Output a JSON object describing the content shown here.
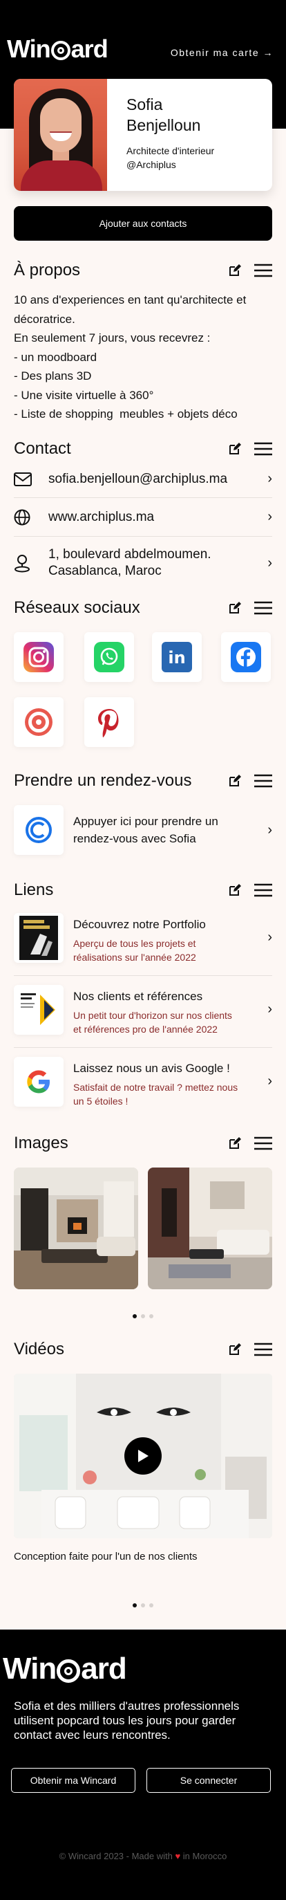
{
  "header": {
    "logo_text_left": "Win",
    "logo_text_right": "ard",
    "get_card_link": "Obtenir ma carte →"
  },
  "profile": {
    "first_name": "Sofia",
    "last_name": "Benjelloun",
    "title": "Architecte d'interieur",
    "company": "@Archiplus",
    "add_contacts_label": "Ajouter aux contacts"
  },
  "about": {
    "title": "À propos",
    "lines": [
      "10 ans d'experiences en tant qu'architecte et",
      "décoratrice.",
      "En seulement 7 jours, vous recevrez :",
      "- un moodboard",
      "- Des plans 3D",
      "- Une visite virtuelle à 360°",
      "- Liste de shopping  meubles + objets déco"
    ]
  },
  "contact": {
    "title": "Contact",
    "email": "sofia.benjelloun@archiplus.ma",
    "website": "www.archiplus.ma",
    "address_line1": "1, boulevard abdelmoumen.",
    "address_line2": "Casablanca, Maroc"
  },
  "social": {
    "title": "Réseaux sociaux",
    "networks": [
      "instagram",
      "whatsapp",
      "linkedin",
      "facebook",
      "other",
      "pinterest"
    ],
    "linkedin_glyph": "in"
  },
  "appointment": {
    "title": "Prendre un rendez-vous",
    "line1": "Appuyer ici pour prendre un",
    "line2": "rendez-vous avec Sofia"
  },
  "links": {
    "title": "Liens",
    "items": [
      {
        "title": "Découvrez notre Portfolio",
        "desc1": "Aperçu de tous les projets et",
        "desc2": "réalisations sur l'année 2022"
      },
      {
        "title": "Nos clients et références",
        "desc1": "Un petit tour d'horizon sur nos clients",
        "desc2": "et références pro de l'année 2022"
      },
      {
        "title": "Laissez nous un avis Google !",
        "desc1": "Satisfait de notre travail ? mettez nous",
        "desc2": "un 5 étoiles !"
      }
    ]
  },
  "images": {
    "title": "Images"
  },
  "videos": {
    "title": "Vidéos",
    "caption": "Conception faite pour l'un de nos clients"
  },
  "footer": {
    "logo_text_left": "Win",
    "logo_text_right": "ard",
    "text1": "Sofia et des milliers d'autres professionnels",
    "text2": "utilisent popcard tous les jours pour garder",
    "text3": "contact avec leurs rencontres.",
    "get_card_button": "Obtenir ma Wincard",
    "login_button": "Se connecter",
    "copyright_left": "© Wincard 2023 - Made with",
    "copyright_right": "in Morocco"
  },
  "colors": {
    "background": "#fdf7f4",
    "dark": "#000000",
    "link_desc": "#8a2b2b",
    "heart": "#e3262f"
  }
}
